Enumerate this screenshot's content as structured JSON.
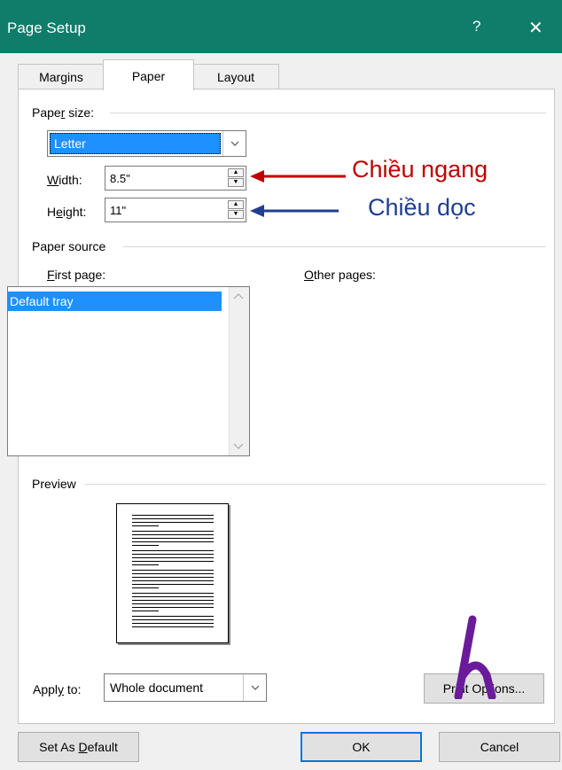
{
  "window": {
    "title": "Page Setup",
    "help_label": "?",
    "close_label": "✕",
    "help_icon": "question-icon",
    "close_icon": "close-icon"
  },
  "tabs": [
    {
      "label": "Margins",
      "selected": false
    },
    {
      "label": "Paper",
      "selected": true
    },
    {
      "label": "Layout",
      "selected": false
    }
  ],
  "paper_size": {
    "group_label_pre": "Pape",
    "group_label_u": "r",
    "group_label_post": " size:",
    "selected": "Letter",
    "width_label_u": "W",
    "width_label_post": "idth:",
    "width_value": "8.5\"",
    "height_label_pre": "H",
    "height_label_u": "e",
    "height_label_post": "ight:",
    "height_value": "11\""
  },
  "annotations": {
    "width_note": "Chiều ngang",
    "height_note": "Chiều dọc",
    "width_color": "#c00000",
    "height_color": "#1f3f8f"
  },
  "paper_source": {
    "group_label": "Paper source",
    "first_page_label_u": "F",
    "first_page_label_post": "irst page:",
    "other_pages_label_u": "O",
    "other_pages_label_post": "ther pages:",
    "first_page_items": [
      "Default tray"
    ]
  },
  "preview": {
    "group_label": "Preview"
  },
  "apply_to": {
    "label_pre": "Appl",
    "label_u": "y",
    "label_post": " to:",
    "value": "Whole document"
  },
  "buttons": {
    "print_options": "Print Options...",
    "set_as_default_pre": "Set As ",
    "set_as_default_u": "D",
    "set_as_default_post": "efault",
    "ok": "OK",
    "cancel": "Cancel"
  },
  "colors": {
    "titlebar": "#107c6a",
    "selection": "#1e90ff",
    "accent_border": "#0078d7",
    "pen_mark": "#6a1b9a"
  }
}
